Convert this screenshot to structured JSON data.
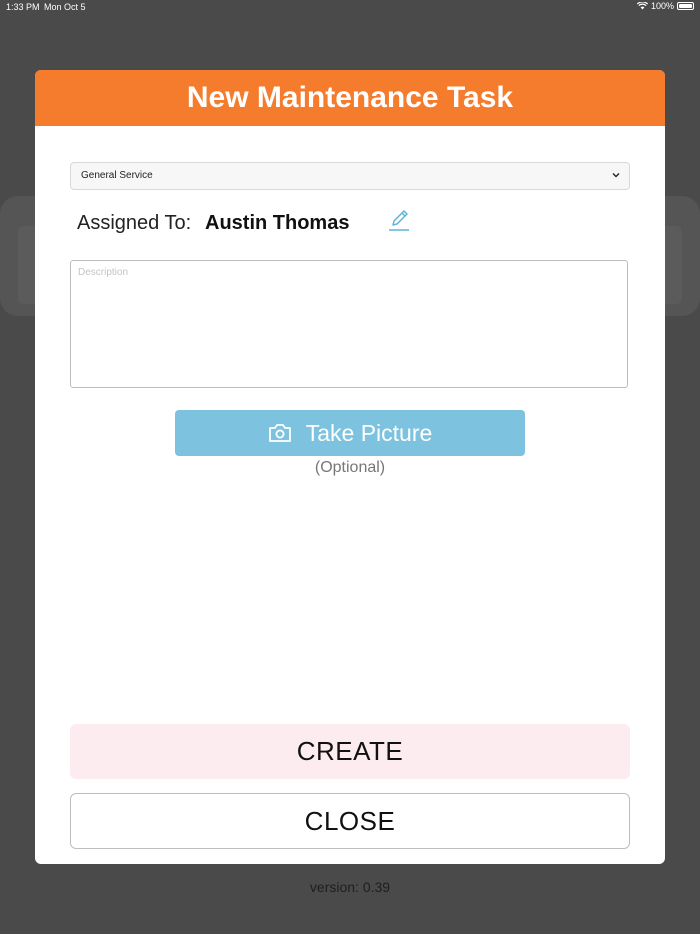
{
  "status_bar": {
    "time": "1:33 PM",
    "date": "Mon Oct 5",
    "battery": "100%"
  },
  "modal": {
    "title": "New Maintenance Task",
    "service_select": {
      "value": "General Service"
    },
    "assigned": {
      "label": "Assigned To:",
      "name": "Austin Thomas"
    },
    "description": {
      "placeholder": "Description",
      "value": ""
    },
    "take_picture": {
      "label": "Take Picture",
      "note": "(Optional)"
    },
    "create_label": "CREATE",
    "close_label": "CLOSE"
  },
  "footer": {
    "version": "version: 0.39"
  },
  "colors": {
    "header": "#f47c2c",
    "picture_button": "#7dc2de",
    "create_bg": "#fdecef",
    "edit_icon": "#5fb3d6"
  }
}
